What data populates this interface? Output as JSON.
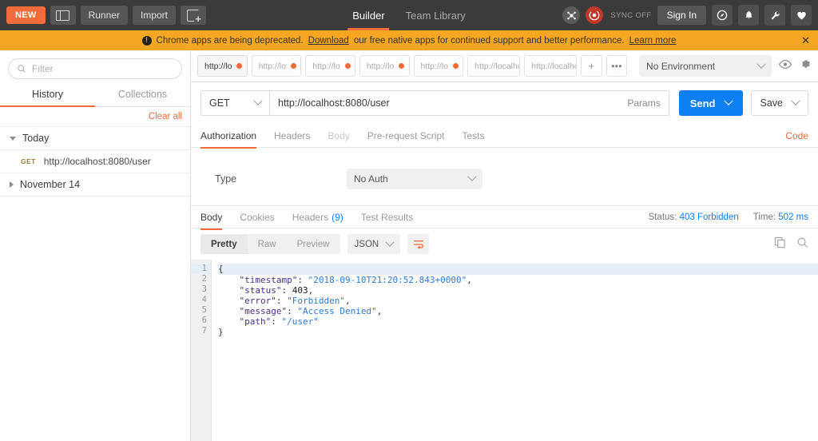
{
  "topbar": {
    "new_label": "NEW",
    "split_icon": "split-pane-icon",
    "runner_label": "Runner",
    "import_label": "Import",
    "newtab_icon": "new-tab-icon",
    "nav": [
      {
        "label": "Builder",
        "active": true
      },
      {
        "label": "Team Library",
        "active": false
      }
    ],
    "sync_icon": "scatter-icon",
    "sync_status_icon": "sync-circle-icon",
    "sync_label": "SYNC OFF",
    "signin_label": "Sign In",
    "icons": [
      "compass-icon",
      "bell-icon",
      "wrench-icon",
      "heart-icon"
    ],
    "accent": "#f26b3a"
  },
  "notice": {
    "alert_icon": "exclamation-icon",
    "text_before": "Chrome apps are being deprecated.",
    "link1": "Download",
    "text_middle": "our free native apps for continued support and better performance.",
    "link2": "Learn more",
    "close_label": "✕",
    "background": "#f5a623"
  },
  "sidebar": {
    "filter_placeholder": "Filter",
    "search_icon": "search-icon",
    "tabs": [
      {
        "label": "History",
        "active": true
      },
      {
        "label": "Collections",
        "active": false
      }
    ],
    "clear_all_label": "Clear all",
    "groups": [
      {
        "label": "Today",
        "expanded": true
      },
      {
        "label": "November 14",
        "expanded": false
      }
    ],
    "history_items": [
      {
        "method": "GET",
        "url": "http://localhost:8080/user"
      }
    ]
  },
  "tabstrip": {
    "tabs": [
      {
        "label": "http://lo",
        "unsaved": true,
        "active": true
      },
      {
        "label": "http://lo",
        "unsaved": true,
        "active": false
      },
      {
        "label": "http://lo",
        "unsaved": true,
        "active": false
      },
      {
        "label": "http://lo",
        "unsaved": true,
        "active": false
      },
      {
        "label": "http://lo",
        "unsaved": true,
        "active": false
      },
      {
        "label": "http://localho",
        "unsaved": false,
        "active": false
      },
      {
        "label": "http://localho",
        "unsaved": false,
        "active": false
      }
    ],
    "add_label": "+",
    "more_label": "•••",
    "environment": "No Environment",
    "eye_icon": "eye-icon",
    "gear_icon": "gear-icon"
  },
  "request": {
    "method": "GET",
    "url": "http://localhost:8080/user",
    "params_label": "Params",
    "send_label": "Send",
    "save_label": "Save",
    "tabs": [
      {
        "label": "Authorization",
        "active": true,
        "dim": false
      },
      {
        "label": "Headers",
        "active": false,
        "dim": false
      },
      {
        "label": "Body",
        "active": false,
        "dim": true
      },
      {
        "label": "Pre-request Script",
        "active": false,
        "dim": false
      },
      {
        "label": "Tests",
        "active": false,
        "dim": false
      }
    ],
    "code_link": "Code",
    "auth_type_label": "Type",
    "auth_type_value": "No Auth"
  },
  "response": {
    "tabs": [
      {
        "label": "Body",
        "active": true,
        "count": ""
      },
      {
        "label": "Cookies",
        "active": false,
        "count": ""
      },
      {
        "label": "Headers",
        "active": false,
        "count": "(9)"
      },
      {
        "label": "Test Results",
        "active": false,
        "count": ""
      }
    ],
    "status_label": "Status:",
    "status_value": "403 Forbidden",
    "time_label": "Time:",
    "time_value": "502 ms",
    "formats": [
      {
        "label": "Pretty",
        "active": true
      },
      {
        "label": "Raw",
        "active": false
      },
      {
        "label": "Preview",
        "active": false
      }
    ],
    "language": "JSON",
    "wrap_icon": "word-wrap-icon",
    "copy_icon": "copy-icon",
    "search_icon": "search-icon",
    "body_lines": [
      {
        "num": "1",
        "fold": true,
        "tokens": [
          {
            "t": "{",
            "c": "p"
          }
        ]
      },
      {
        "num": "2",
        "fold": false,
        "tokens": [
          {
            "t": "    \"timestamp\"",
            "c": "k"
          },
          {
            "t": ": ",
            "c": "p"
          },
          {
            "t": "\"2018-09-10T21:20:52.843+0000\"",
            "c": "s"
          },
          {
            "t": ",",
            "c": "p"
          }
        ]
      },
      {
        "num": "3",
        "fold": false,
        "tokens": [
          {
            "t": "    \"status\"",
            "c": "k"
          },
          {
            "t": ": ",
            "c": "p"
          },
          {
            "t": "403",
            "c": "n"
          },
          {
            "t": ",",
            "c": "p"
          }
        ]
      },
      {
        "num": "4",
        "fold": false,
        "tokens": [
          {
            "t": "    \"error\"",
            "c": "k"
          },
          {
            "t": ": ",
            "c": "p"
          },
          {
            "t": "\"Forbidden\"",
            "c": "s"
          },
          {
            "t": ",",
            "c": "p"
          }
        ]
      },
      {
        "num": "5",
        "fold": false,
        "tokens": [
          {
            "t": "    \"message\"",
            "c": "k"
          },
          {
            "t": ": ",
            "c": "p"
          },
          {
            "t": "\"Access Denied\"",
            "c": "s"
          },
          {
            "t": ",",
            "c": "p"
          }
        ]
      },
      {
        "num": "6",
        "fold": false,
        "tokens": [
          {
            "t": "    \"path\"",
            "c": "k"
          },
          {
            "t": ": ",
            "c": "p"
          },
          {
            "t": "\"/user\"",
            "c": "s"
          }
        ]
      },
      {
        "num": "7",
        "fold": false,
        "tokens": [
          {
            "t": "}",
            "c": "p"
          }
        ]
      }
    ]
  }
}
